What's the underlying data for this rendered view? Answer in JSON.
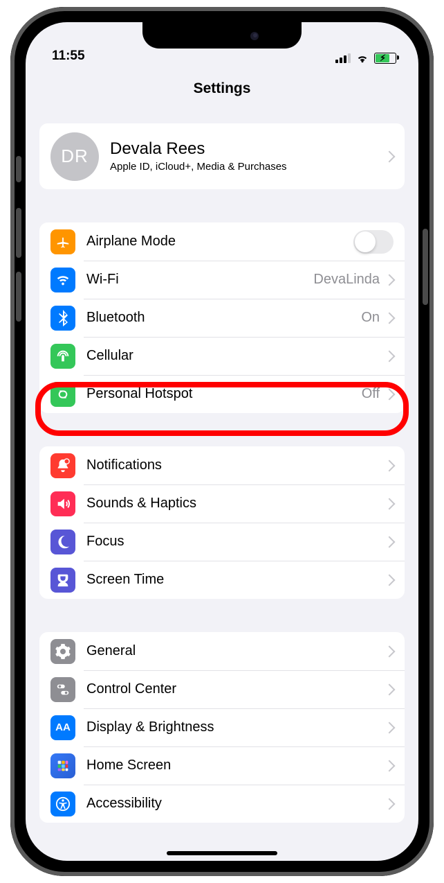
{
  "status": {
    "time": "11:55"
  },
  "nav": {
    "title": "Settings"
  },
  "profile": {
    "initials": "DR",
    "name": "Devala Rees",
    "subtitle": "Apple ID, iCloud+, Media & Purchases"
  },
  "rows": {
    "airplane": {
      "label": "Airplane Mode"
    },
    "wifi": {
      "label": "Wi-Fi",
      "value": "DevaLinda"
    },
    "bluetooth": {
      "label": "Bluetooth",
      "value": "On"
    },
    "cellular": {
      "label": "Cellular"
    },
    "hotspot": {
      "label": "Personal Hotspot",
      "value": "Off"
    },
    "notifications": {
      "label": "Notifications"
    },
    "sounds": {
      "label": "Sounds & Haptics"
    },
    "focus": {
      "label": "Focus"
    },
    "screentime": {
      "label": "Screen Time"
    },
    "general": {
      "label": "General"
    },
    "controlcenter": {
      "label": "Control Center"
    },
    "display": {
      "label": "Display & Brightness"
    },
    "homescreen": {
      "label": "Home Screen"
    },
    "accessibility": {
      "label": "Accessibility"
    }
  },
  "colors": {
    "highlight": "#ff0000",
    "bg": "#f2f2f7",
    "card": "#ffffff"
  }
}
